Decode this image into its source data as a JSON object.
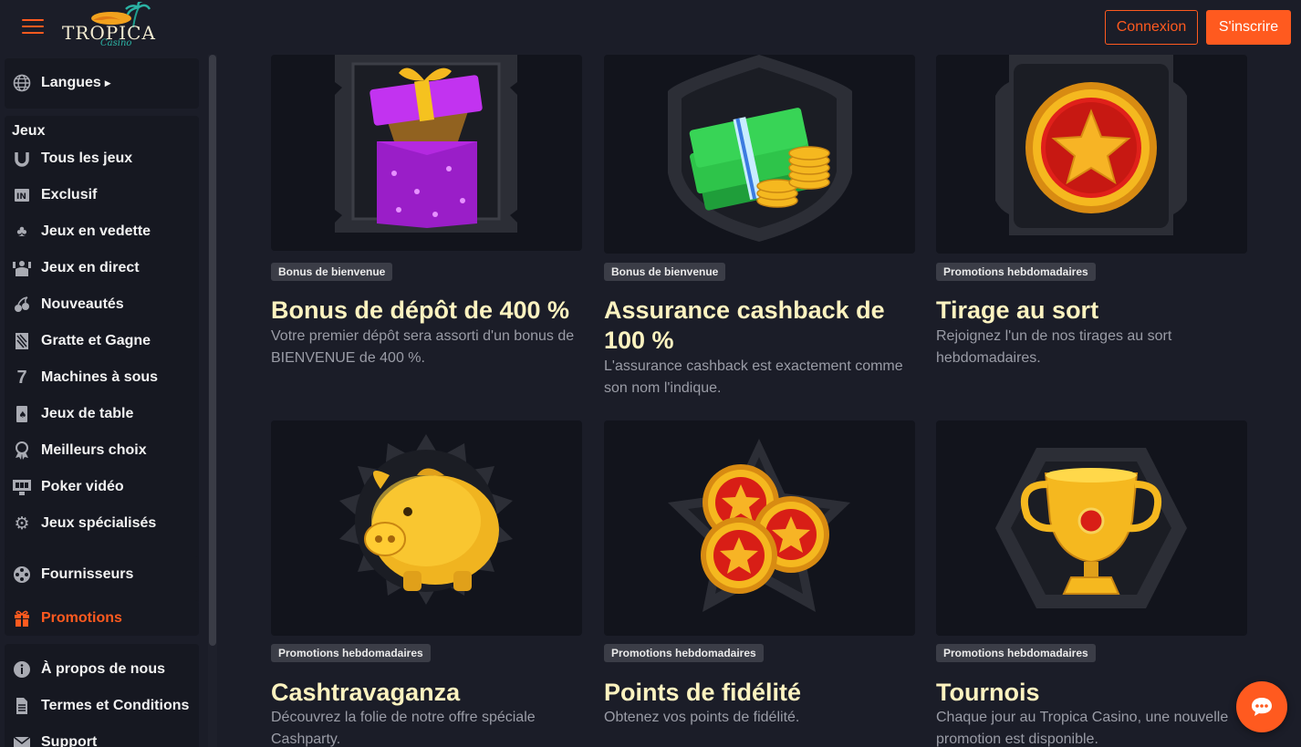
{
  "header": {
    "menu_icon": "hamburger-icon",
    "logo_text": "TROPICA",
    "logo_sub": "Casino",
    "login_label": "Connexion",
    "signup_label": "S'inscrire",
    "accent_color": "#ff5a1f"
  },
  "sidebar": {
    "languages": {
      "label": "Langues",
      "icon": "globe-icon"
    },
    "games_heading": "Jeux",
    "games": [
      {
        "label": "Tous les jeux",
        "icon": "horseshoe-icon"
      },
      {
        "label": "Exclusif",
        "icon": "exclusive-icon"
      },
      {
        "label": "Jeux en vedette",
        "icon": "clover-icon"
      },
      {
        "label": "Jeux en direct",
        "icon": "dealer-icon"
      },
      {
        "label": "Nouveautés",
        "icon": "cherries-icon"
      },
      {
        "label": "Gratte et Gagne",
        "icon": "scratch-card-icon"
      },
      {
        "label": "Machines à sous",
        "icon": "seven-icon"
      },
      {
        "label": "Jeux de table",
        "icon": "card-spade-icon"
      },
      {
        "label": "Meilleurs choix",
        "icon": "award-icon"
      },
      {
        "label": "Poker vidéo",
        "icon": "video-poker-icon"
      },
      {
        "label": "Jeux spécialisés",
        "icon": "gear-icon"
      }
    ],
    "providers": {
      "label": "Fournisseurs",
      "icon": "film-reel-icon"
    },
    "promotions": {
      "label": "Promotions",
      "icon": "gift-icon"
    },
    "info": [
      {
        "label": "À propos de nous",
        "icon": "info-icon"
      },
      {
        "label": "Termes et Conditions",
        "icon": "document-icon"
      },
      {
        "label": "Support",
        "icon": "mail-icon"
      }
    ]
  },
  "promotions": [
    {
      "tag": "Bonus de bienvenue",
      "title": "Bonus de dépôt de 400 %",
      "desc": "Votre premier dépôt sera assorti d'un bonus de BIENVENUE de 400 %.",
      "icon": "gift-box-icon"
    },
    {
      "tag": "Bonus de bienvenue",
      "title": "Assurance cashback de 100 %",
      "desc": "L'assurance cashback est exactement comme son nom l'indique.",
      "icon": "cash-coins-icon"
    },
    {
      "tag": "Promotions hebdomadaires",
      "title": "Tirage au sort",
      "desc": "Rejoignez l'un de nos tirages au sort hebdomadaires.",
      "icon": "star-medal-icon"
    },
    {
      "tag": "Promotions hebdomadaires",
      "title": "Cashtravaganza",
      "desc": "Découvrez la folie de notre offre spéciale Cashparty.",
      "icon": "piggy-bank-icon"
    },
    {
      "tag": "Promotions hebdomadaires",
      "title": "Points de fidélité",
      "desc": "Obtenez vos points de fidélité.",
      "icon": "star-coins-icon"
    },
    {
      "tag": "Promotions hebdomadaires",
      "title": "Tournois",
      "desc": "Chaque jour au Tropica Casino, une nouvelle promotion est disponible.",
      "icon": "trophy-icon"
    }
  ],
  "chat": {
    "icon": "chat-icon"
  }
}
